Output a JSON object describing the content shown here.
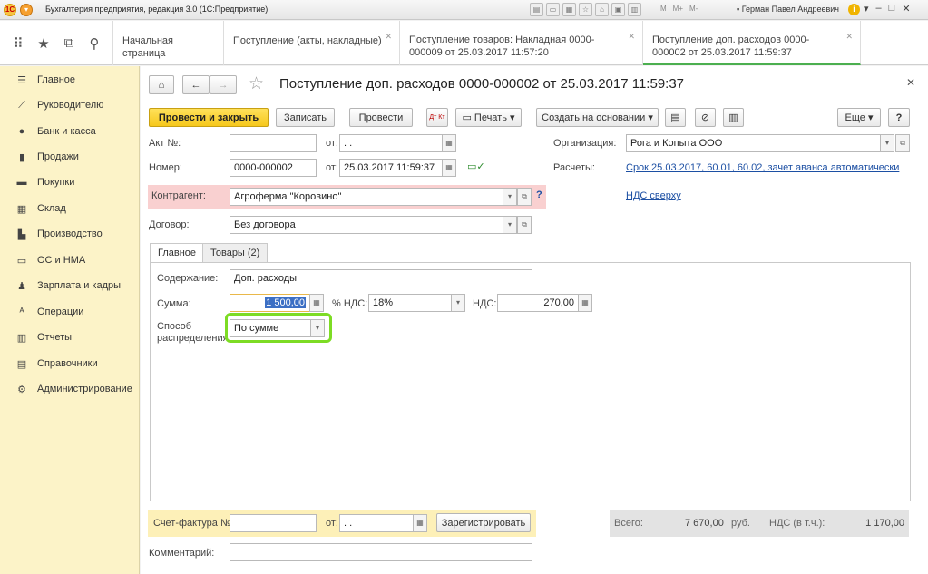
{
  "window": {
    "title": "Бухгалтерия предприятия, редакция 3.0  (1С:Предприятие)",
    "logo_text": "1С",
    "mode_buttons": [
      "M",
      "M+",
      "M-"
    ],
    "user": "Герман Павел Андреевич",
    "info_glyph": "i"
  },
  "tabs": [
    {
      "label": "Начальная страница",
      "closable": false
    },
    {
      "label": "Поступление (акты, накладные)",
      "closable": true
    },
    {
      "label": "Поступление товаров: Накладная 0000-000009 от 25.03.2017 11:57:20",
      "closable": true
    },
    {
      "label": "Поступление доп. расходов 0000-000002 от 25.03.2017 11:59:37",
      "closable": true,
      "active": true
    }
  ],
  "sidebar": {
    "items": [
      {
        "label": "Главное",
        "icon": "menu-icon",
        "glyph": "☰"
      },
      {
        "label": "Руководителю",
        "icon": "chart-line-icon",
        "glyph": "⟋"
      },
      {
        "label": "Банк и касса",
        "icon": "coin-icon",
        "glyph": "●"
      },
      {
        "label": "Продажи",
        "icon": "bag-icon",
        "glyph": "▮"
      },
      {
        "label": "Покупки",
        "icon": "cart-icon",
        "glyph": "▬"
      },
      {
        "label": "Склад",
        "icon": "warehouse-icon",
        "glyph": "▦"
      },
      {
        "label": "Производство",
        "icon": "factory-icon",
        "glyph": "▙"
      },
      {
        "label": "ОС и НМА",
        "icon": "truck-icon",
        "glyph": "▭"
      },
      {
        "label": "Зарплата и кадры",
        "icon": "person-icon",
        "glyph": "♟"
      },
      {
        "label": "Операции",
        "icon": "operations-icon",
        "glyph": "ᴬ"
      },
      {
        "label": "Отчеты",
        "icon": "bar-chart-icon",
        "glyph": "▥"
      },
      {
        "label": "Справочники",
        "icon": "book-icon",
        "glyph": "▤"
      },
      {
        "label": "Администрирование",
        "icon": "gear-icon",
        "glyph": "⚙"
      }
    ]
  },
  "document": {
    "title": "Поступление доп. расходов 0000-000002 от 25.03.2017 11:59:37",
    "toolbar": {
      "post_close": "Провести и закрыть",
      "save": "Записать",
      "post": "Провести",
      "dtkt": "Дт Кт",
      "print": "Печать",
      "create_based": "Создать на основании",
      "more": "Еще",
      "help": "?"
    },
    "fields": {
      "act_no_label": "Акт №:",
      "act_no": "",
      "from_label": "от:",
      "act_date": " .  .",
      "number_label": "Номер:",
      "number": "0000-000002",
      "date": "25.03.2017 11:59:37",
      "org_label": "Организация:",
      "org": "Рога и Копыта ООО",
      "settlements_label": "Расчеты:",
      "settlements_link": "Срок 25.03.2017, 60.01, 60.02, зачет аванса автоматически",
      "vat_link": "НДС сверху",
      "counterparty_label": "Контрагент:",
      "counterparty": "Агроферма \"Коровино\"",
      "counterparty_help": "?",
      "contract_label": "Договор:",
      "contract": "Без договора"
    },
    "inner_tabs": [
      "Главное",
      "Товары (2)"
    ],
    "main_tab": {
      "content_label": "Содержание:",
      "content": "Доп. расходы",
      "sum_label": "Сумма:",
      "sum": "1 500,00",
      "vat_rate_label": "% НДС:",
      "vat_rate": "18%",
      "vat_label": "НДС:",
      "vat": "270,00",
      "distribution_label_1": "Способ",
      "distribution_label_2": "распределения:",
      "distribution": "По сумме"
    },
    "footer": {
      "invoice_label": "Счет-фактура №:",
      "invoice_no": "",
      "invoice_from_label": "от:",
      "invoice_date": " .  .",
      "register": "Зарегистрировать",
      "total_label": "Всего:",
      "total": "7 670,00",
      "currency": "руб.",
      "vat_incl_label": "НДС (в т.ч.):",
      "vat_incl": "1 170,00",
      "comment_label": "Комментарий:",
      "comment": ""
    }
  },
  "colors": {
    "sidebar_bg": "#fcf3c8",
    "primary_button": "#f6c81c",
    "highlight": "#7ddc24",
    "required_bg": "#f9d0d0",
    "link": "#1c4fa3",
    "active_tab_underline": "#4caf50"
  }
}
